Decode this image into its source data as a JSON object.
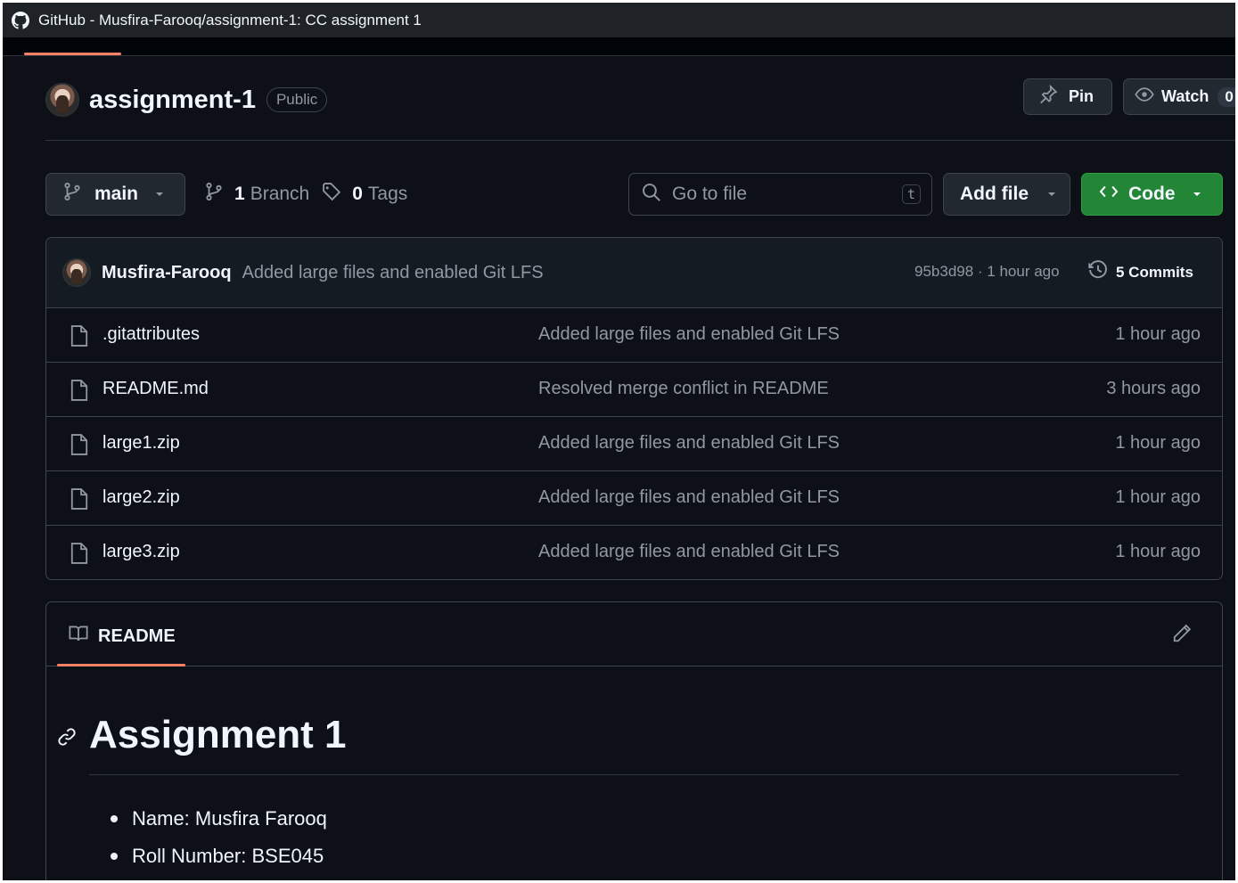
{
  "window": {
    "title": "GitHub - Musfira-Farooq/assignment-1: CC assignment 1"
  },
  "repo": {
    "name": "assignment-1",
    "visibility": "Public"
  },
  "actions": {
    "pin": "Pin",
    "watch": "Watch",
    "watch_count": "0"
  },
  "toolbar": {
    "branch": "main",
    "branch_count": "1",
    "branch_label": "Branch",
    "tag_count": "0",
    "tag_label": "Tags",
    "search_placeholder": "Go to file",
    "search_shortcut": "t",
    "add_file": "Add file",
    "code": "Code"
  },
  "latest_commit": {
    "author": "Musfira-Farooq",
    "message": "Added large files and enabled Git LFS",
    "meta": "95b3d98 · 1 hour ago",
    "commits": "5 Commits"
  },
  "files": [
    {
      "name": ".gitattributes",
      "message": "Added large files and enabled Git LFS",
      "time": "1 hour ago"
    },
    {
      "name": "README.md",
      "message": "Resolved merge conflict in README",
      "time": "3 hours ago"
    },
    {
      "name": "large1.zip",
      "message": "Added large files and enabled Git LFS",
      "time": "1 hour ago"
    },
    {
      "name": "large2.zip",
      "message": "Added large files and enabled Git LFS",
      "time": "1 hour ago"
    },
    {
      "name": "large3.zip",
      "message": "Added large files and enabled Git LFS",
      "time": "1 hour ago"
    }
  ],
  "readme": {
    "tab": "README",
    "heading": "Assignment 1",
    "items": [
      "Name: Musfira Farooq",
      "Roll Number: BSE045"
    ]
  },
  "icons": {
    "github": "github-mark-icon",
    "pin": "pin-icon",
    "watch": "eye-icon",
    "branch": "git-branch-icon",
    "tag": "tag-icon",
    "search": "search-icon",
    "code": "code-icon",
    "history": "history-icon",
    "file": "file-icon",
    "book": "book-icon",
    "pencil": "pencil-icon",
    "link": "link-icon"
  },
  "colors": {
    "background": "#0d1117",
    "accent": "#f78166",
    "code_button": "#238636",
    "muted": "#9198a1"
  }
}
